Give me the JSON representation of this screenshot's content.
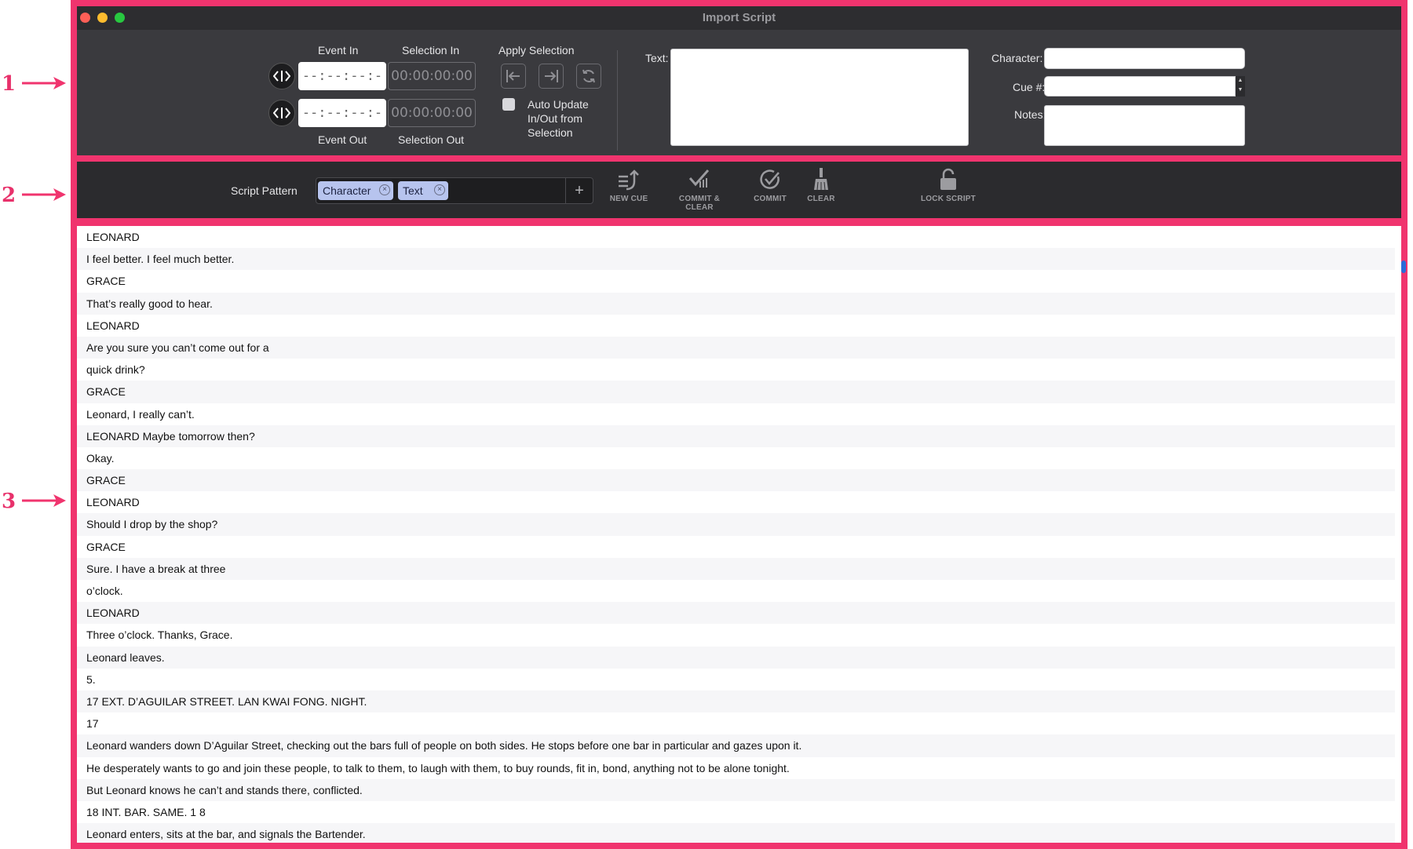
{
  "annotations": [
    "1",
    "2",
    "3"
  ],
  "window": {
    "title": "Import Script"
  },
  "timing": {
    "event_in_label": "Event In",
    "event_out_label": "Event Out",
    "event_in_value": "--:--:--:--",
    "event_out_value": "--:--:--:--",
    "selection_in_label": "Selection In",
    "selection_out_label": "Selection Out",
    "selection_in_value": "00:00:00:00",
    "selection_out_value": "00:00:00:00",
    "apply_selection_label": "Apply Selection",
    "auto_update_label": "Auto Update In/Out from Selection"
  },
  "fields": {
    "text_label": "Text:",
    "character_label": "Character:",
    "cue_label": "Cue #:",
    "notes_label": "Notes:"
  },
  "toolbar": {
    "script_pattern_label": "Script Pattern",
    "tokens": [
      "Character",
      "Text"
    ],
    "plus": "+",
    "new_cue": "NEW CUE",
    "commit_clear": "COMMIT & CLEAR",
    "commit": "COMMIT",
    "clear": "CLEAR",
    "lock_script": "LOCK SCRIPT"
  },
  "script_lines": [
    "LEONARD",
    "I feel better. I feel much better.",
    "GRACE",
    "That’s really good to hear.",
    "LEONARD",
    "Are you sure you can’t come out for a",
    "quick drink?",
    "GRACE",
    "Leonard, I really can’t.",
    "LEONARD Maybe tomorrow then?",
    "Okay.",
    "GRACE",
    "LEONARD",
    "Should I drop by the shop?",
    "GRACE",
    "Sure. I have a break at three",
    "o’clock.",
    "LEONARD",
    "Three o’clock. Thanks, Grace.",
    "Leonard leaves.",
    "5.",
    "17 EXT. D’AGUILAR STREET. LAN KWAI FONG. NIGHT.",
    "17",
    "Leonard wanders down D’Aguilar Street, checking out the bars full of people on both sides. He stops before one bar in particular and gazes upon it.",
    "He desperately wants to go and join these people, to talk to them, to laugh with them, to buy rounds, fit in, bond, anything not to be alone tonight.",
    "But Leonard knows he can’t and stands there, conflicted.",
    "18 INT. BAR. SAME. 1 8",
    "Leonard enters, sits at the bar, and signals the Bartender."
  ],
  "colors": {
    "accent": "#f0346e",
    "token": "#b7c4ee",
    "scroll": "#2a6bd8"
  }
}
